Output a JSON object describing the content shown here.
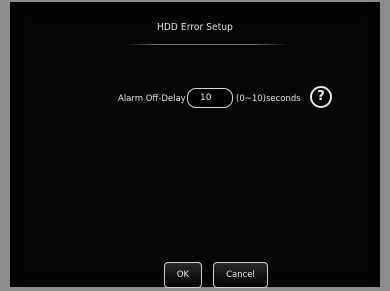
{
  "dialog": {
    "title": "HDD Error Setup"
  },
  "alarm_off_delay": {
    "label": "Alarm Off-Delay",
    "value": "10",
    "range_text": "(0~10)seconds",
    "help_symbol": "?"
  },
  "buttons": {
    "ok_label": "OK",
    "cancel_label": "Cancel"
  },
  "icons": {
    "help": "help-question-icon"
  },
  "colors": {
    "background": "#050505",
    "text": "#e4e4e4",
    "border": "#d8d8d8"
  }
}
